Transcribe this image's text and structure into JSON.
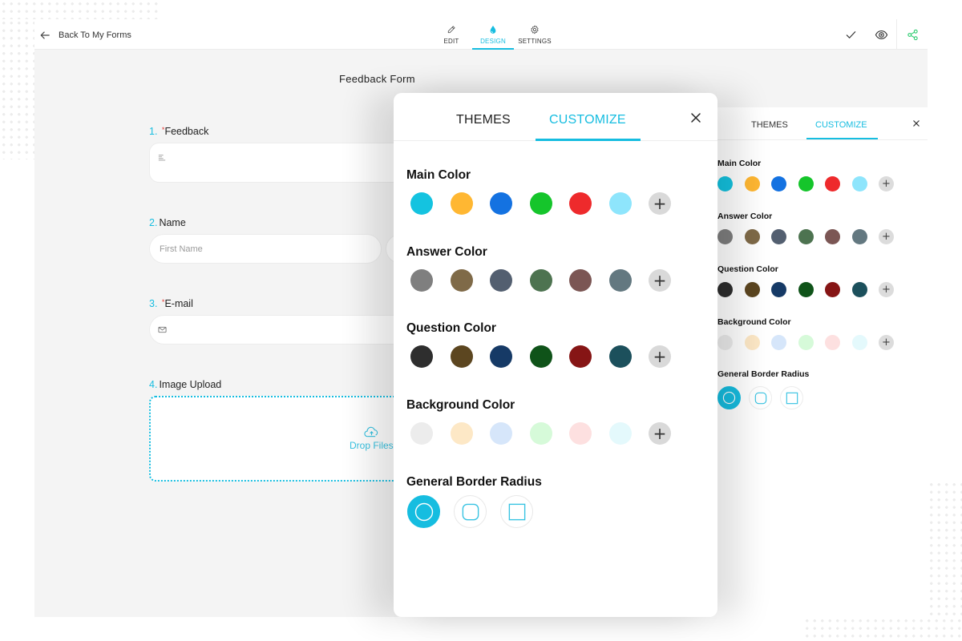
{
  "topbar": {
    "back_label": "Back To My Forms",
    "nav": [
      {
        "label": "EDIT",
        "icon": "pencil-icon",
        "active": false
      },
      {
        "label": "DESIGN",
        "icon": "droplet-icon",
        "active": true
      },
      {
        "label": "SETTINGS",
        "icon": "gear-icon",
        "active": false
      }
    ],
    "actions": [
      "check-icon",
      "eye-icon",
      "share-icon"
    ]
  },
  "form": {
    "title": "Feedback Form",
    "questions": [
      {
        "number": "1.",
        "required": true,
        "label": "Feedback",
        "type": "textarea"
      },
      {
        "number": "2.",
        "required": false,
        "label": "Name",
        "type": "name",
        "placeholder_first": "First Name"
      },
      {
        "number": "3.",
        "required": true,
        "label": "E-mail",
        "type": "email"
      },
      {
        "number": "4.",
        "required": false,
        "label": "Image Upload",
        "type": "upload",
        "drop_label": "Drop Files"
      }
    ],
    "required_mark": "*"
  },
  "colors": {
    "accent": "#16bde0",
    "main": [
      "#14c3e0",
      "#ffb732",
      "#1472e1",
      "#15c52b",
      "#ee2a2c",
      "#8ee5fc"
    ],
    "answer": [
      "#7f7f7f",
      "#7f6a48",
      "#535f70",
      "#4d7350",
      "#7b5654",
      "#637880"
    ],
    "question": [
      "#2e2e2e",
      "#5c4620",
      "#163a66",
      "#0f5319",
      "#861515",
      "#1c505c"
    ],
    "background": [
      "#ececec",
      "#fde8c6",
      "#d6e6fa",
      "#d6fad9",
      "#fde0e0",
      "#e4f9fc"
    ]
  },
  "modal": {
    "tabs": [
      {
        "label": "THEMES",
        "active": false
      },
      {
        "label": "CUSTOMIZE",
        "active": true
      }
    ],
    "sections": {
      "main_color": "Main Color",
      "answer_color": "Answer Color",
      "question_color": "Question Color",
      "background_color": "Background Color",
      "border_radius": "General Border Radius"
    },
    "add_label": "+",
    "border_radius_options": [
      "round",
      "rounded",
      "square"
    ],
    "border_radius_selected": "round"
  },
  "side_panel": {
    "tabs": [
      {
        "label": "THEMES",
        "active": false
      },
      {
        "label": "CUSTOMIZE",
        "active": true
      }
    ],
    "sections": {
      "main_color": "Main Color",
      "answer_color": "Answer Color",
      "question_color": "Question Color",
      "background_color": "Background Color",
      "border_radius": "General Border Radius"
    },
    "add_label": "+"
  }
}
